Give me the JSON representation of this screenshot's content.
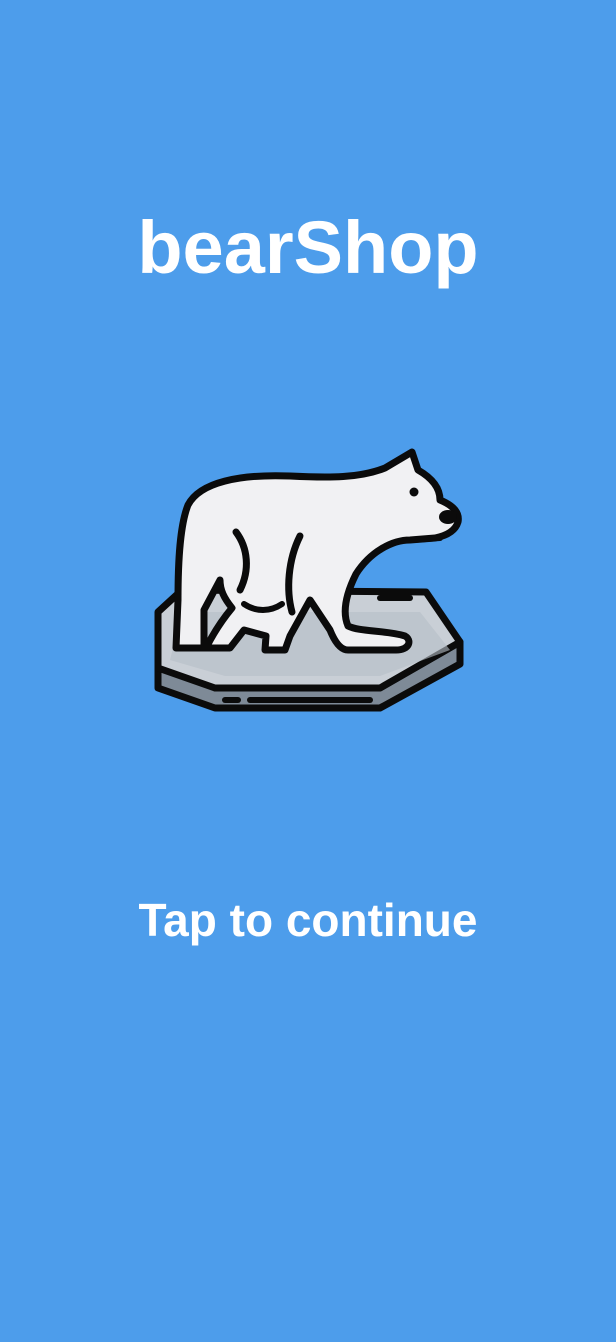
{
  "app": {
    "title": "bearShop",
    "tap_prompt": "Tap to continue"
  },
  "logo": {
    "icon": "polar-bear-on-ice-floe-icon"
  },
  "colors": {
    "background": "#4d9deb",
    "text": "#ffffff",
    "bear_fill": "#f1f1f3",
    "ice_top": "#c9cfd6",
    "ice_side": "#7e8a97",
    "outline": "#0b0b0b"
  }
}
